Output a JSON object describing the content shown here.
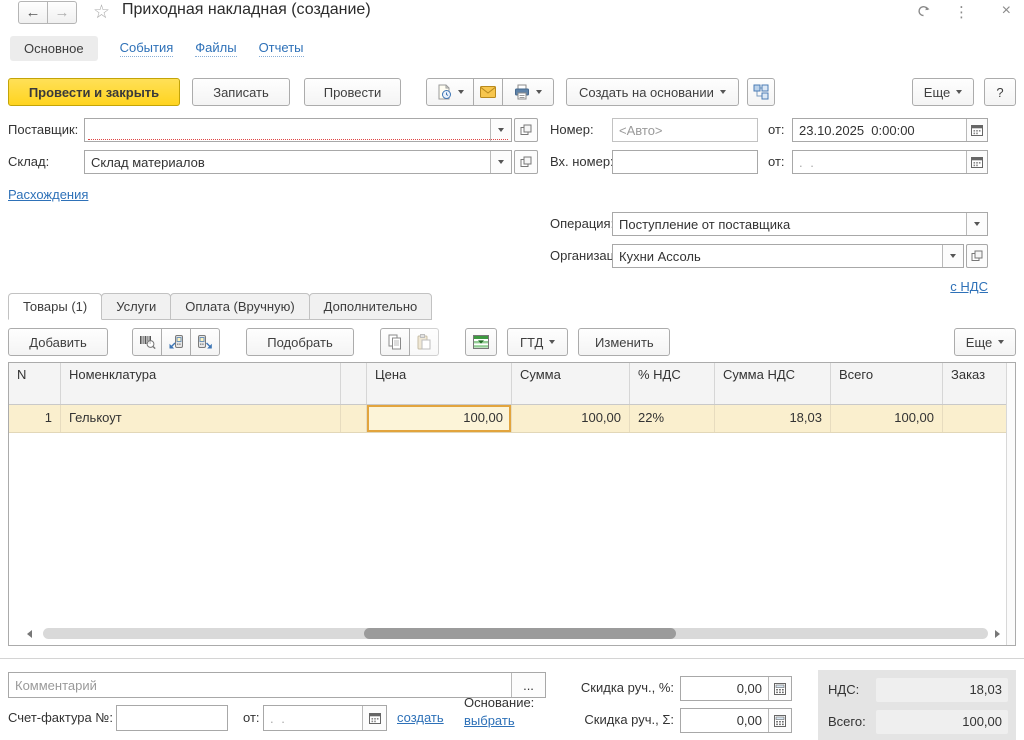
{
  "icons": {
    "back": "←",
    "forward": "→",
    "star": "☆",
    "more_vertical": "⋮",
    "close": "×",
    "ellipsis": "..."
  },
  "header": {
    "title": "Приходная накладная (создание)"
  },
  "nav_tabs": {
    "main": "Основное",
    "events": "События",
    "files": "Файлы",
    "reports": "Отчеты"
  },
  "toolbar": {
    "post_and_close": "Провести и закрыть",
    "save": "Записать",
    "post": "Провести",
    "create_based_on": "Создать на основании",
    "more": "Еще",
    "help": "?"
  },
  "form": {
    "supplier": {
      "label": "Поставщик:",
      "value": ""
    },
    "warehouse": {
      "label": "Склад:",
      "value": "Склад материалов"
    },
    "discrepancies_link": "Расхождения",
    "number": {
      "label": "Номер:",
      "placeholder": "<Авто>"
    },
    "date": {
      "label": "от:",
      "value": "23.10.2025  0:00:00"
    },
    "incoming_number": {
      "label": "Вх. номер:",
      "value": ""
    },
    "incoming_date": {
      "label": "от:",
      "value": ". ."
    },
    "operation": {
      "label": "Операция:",
      "value": "Поступление от поставщика"
    },
    "organization": {
      "label": "Организация:",
      "value": "Кухни Ассоль"
    },
    "vat_link": "с НДС"
  },
  "section_tabs": {
    "goods": "Товары (1)",
    "services": "Услуги",
    "payment": "Оплата (Вручную)",
    "additional": "Дополнительно"
  },
  "table_toolbar": {
    "add": "Добавить",
    "pick": "Подобрать",
    "gtd": "ГТД",
    "edit": "Изменить",
    "more": "Еще"
  },
  "table": {
    "columns": [
      "N",
      "Номенклатура",
      "",
      "Цена",
      "Сумма",
      "% НДС",
      "Сумма НДС",
      "Всего",
      "Заказ"
    ],
    "rows": [
      {
        "n": "1",
        "nomenclature": "Гелькоут",
        "price": "100,00",
        "sum": "100,00",
        "vat_percent": "22%",
        "vat_sum": "18,03",
        "total": "100,00",
        "order": ""
      }
    ]
  },
  "footer": {
    "comment_placeholder": "Комментарий",
    "invoice": {
      "label": "Счет-фактура №:",
      "value": ""
    },
    "invoice_date": {
      "label": "от:",
      "value": ". ."
    },
    "create_link": "создать",
    "basis_label": "Основание:",
    "basis_link": "выбрать",
    "discount_percent": {
      "label": "Скидка руч., %:",
      "value": "0,00"
    },
    "discount_sum": {
      "label": "Скидка руч., Σ:",
      "value": "0,00"
    },
    "totals": {
      "vat_label": "НДС:",
      "vat_value": "18,03",
      "total_label": "Всего:",
      "total_value": "100,00"
    }
  }
}
